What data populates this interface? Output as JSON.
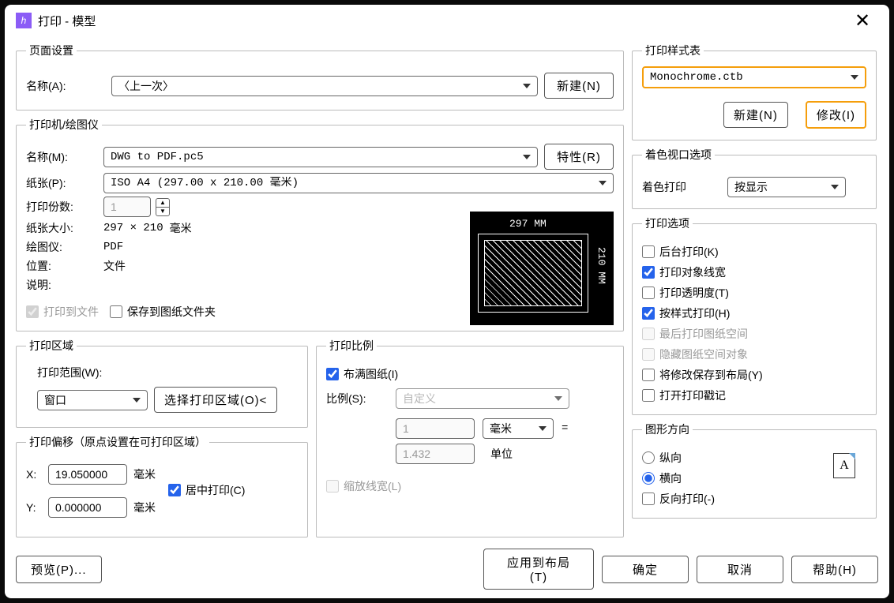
{
  "window": {
    "title": "打印 - 模型"
  },
  "pageSetup": {
    "legend": "页面设置",
    "nameLabel": "名称(A):",
    "nameValue": "〈上一次〉",
    "newBtn": "新建(N)"
  },
  "printer": {
    "legend": "打印机/绘图仪",
    "nameLabel": "名称(M):",
    "nameValue": "DWG to PDF.pc5",
    "propsBtn": "特性(R)",
    "paperLabel": "纸张(P):",
    "paperValue": "ISO A4 (297.00 x 210.00 毫米)",
    "copiesLabel": "打印份数:",
    "copiesValue": "1",
    "sizeLabel": "纸张大小:",
    "sizeValue": "297 × 210",
    "sizeUnit": "毫米",
    "plotterLabel": "绘图仪:",
    "plotterValue": "PDF",
    "locationLabel": "位置:",
    "locationValue": "文件",
    "descLabel": "说明:",
    "printToFileLabel": "打印到文件",
    "saveToFolderLabel": "保存到图纸文件夹",
    "previewWidth": "297 MM",
    "previewHeight": "210 MM"
  },
  "printArea": {
    "legend": "打印区域",
    "rangeLabel": "打印范围(W):",
    "rangeValue": "窗口",
    "selectBtn": "选择打印区域(O)<"
  },
  "offset": {
    "legend": "打印偏移（原点设置在可打印区域）",
    "xLabel": "X:",
    "xValue": "19.050000",
    "yLabel": "Y:",
    "yValue": "0.000000",
    "unit": "毫米",
    "centerLabel": "居中打印(C)"
  },
  "scale": {
    "legend": "打印比例",
    "fitLabel": "布满图纸(I)",
    "scaleLabel": "比例(S):",
    "scaleValue": "自定义",
    "topValue": "1",
    "topUnit": "毫米",
    "equals": "=",
    "botValue": "1.432",
    "botUnit": "单位",
    "scaleLineweightLabel": "缩放线宽(L)"
  },
  "styleTable": {
    "legend": "打印样式表",
    "value": "Monochrome.ctb",
    "newBtn": "新建(N)",
    "modifyBtn": "修改(I)"
  },
  "viewport": {
    "legend": "着色视口选项",
    "shadeLabel": "着色打印",
    "shadeValue": "按显示"
  },
  "options": {
    "legend": "打印选项",
    "bgLabel": "后台打印(K)",
    "lwLabel": "打印对象线宽",
    "transLabel": "打印透明度(T)",
    "styleLabel": "按样式打印(H)",
    "lastPaperLabel": "最后打印图纸空间",
    "hidePaperLabel": "隐藏图纸空间对象",
    "saveLabel": "将修改保存到布局(Y)",
    "stampLabel": "打开打印戳记"
  },
  "orient": {
    "legend": "图形方向",
    "portraitLabel": "纵向",
    "landscapeLabel": "横向",
    "reverseLabel": "反向打印(-)",
    "iconLetter": "A"
  },
  "footer": {
    "preview": "预览(P)...",
    "apply": "应用到布局(T)",
    "ok": "确定",
    "cancel": "取消",
    "help": "帮助(H)"
  }
}
